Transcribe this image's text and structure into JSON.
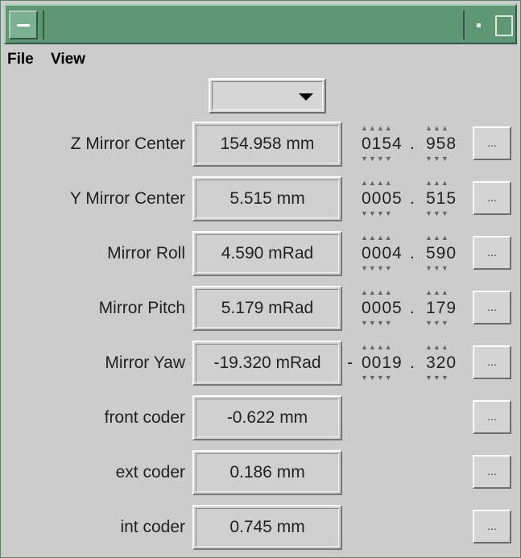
{
  "window": {
    "system_menu_icon": "window-menu-icon",
    "minimize_icon": "minimize-icon",
    "maximize_icon": "maximize-icon"
  },
  "menubar": {
    "file": "File",
    "view": "View"
  },
  "selector": {
    "value": ""
  },
  "rows": [
    {
      "label": "Z Mirror Center",
      "value": "154.958 mm",
      "sign": "",
      "int": "0154",
      "frac": "958",
      "button": "..."
    },
    {
      "label": "Y Mirror Center",
      "value": "5.515 mm",
      "sign": "",
      "int": "0005",
      "frac": "515",
      "button": "..."
    },
    {
      "label": "Mirror Roll",
      "value": "4.590 mRad",
      "sign": "",
      "int": "0004",
      "frac": "590",
      "button": "..."
    },
    {
      "label": "Mirror Pitch",
      "value": "5.179 mRad",
      "sign": "",
      "int": "0005",
      "frac": "179",
      "button": "..."
    },
    {
      "label": "Mirror Yaw",
      "value": "-19.320 mRad",
      "sign": "-",
      "int": "0019",
      "frac": "320",
      "button": "..."
    },
    {
      "label": "front coder",
      "value": "-0.622 mm",
      "button": "..."
    },
    {
      "label": "ext coder",
      "value": "0.186 mm",
      "button": "..."
    },
    {
      "label": "int coder",
      "value": "0.745 mm",
      "button": "..."
    }
  ],
  "wheel_dot": "."
}
